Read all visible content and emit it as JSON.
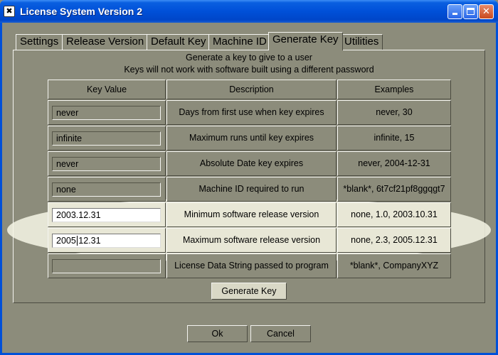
{
  "window": {
    "title": "License System Version 2",
    "app_icon": "✖"
  },
  "tabs": [
    {
      "label": "Settings"
    },
    {
      "label": "Release Version"
    },
    {
      "label": "Default Key"
    },
    {
      "label": "Machine ID"
    },
    {
      "label": "Generate Key"
    },
    {
      "label": "Utilities"
    }
  ],
  "active_tab": "Generate Key",
  "panel": {
    "line1": "Generate a key to give to a user",
    "line2": "Keys will not work with software built using a different password"
  },
  "table": {
    "headers": [
      "Key Value",
      "Description",
      "Examples"
    ],
    "rows": [
      {
        "value": "never",
        "description": "Days from first use when key expires",
        "examples": "never, 30"
      },
      {
        "value": "infinite",
        "description": "Maximum runs until key expires",
        "examples": "infinite, 15"
      },
      {
        "value": "never",
        "description": "Absolute Date key expires",
        "examples": "never, 2004-12-31"
      },
      {
        "value": "none",
        "description": "Machine ID required to run",
        "examples": "*blank*, 6t7cf21pf8ggqgt7"
      },
      {
        "value": "2003.12.31",
        "description": "Minimum software release version",
        "examples": "none, 1.0, 2003.10.31"
      },
      {
        "value": "2005.12.31",
        "description": "Maximum software release version",
        "examples": "none, 2.3, 2005.12.31"
      },
      {
        "value": "",
        "description": "License Data String passed to program",
        "examples": "*blank*, CompanyXYZ"
      }
    ]
  },
  "buttons": {
    "generate": "Generate Key",
    "ok": "Ok",
    "cancel": "Cancel"
  },
  "colors": {
    "titlebar": "#0050d8",
    "face": "#8c8c7b",
    "highlight": "#f6f6e6"
  }
}
